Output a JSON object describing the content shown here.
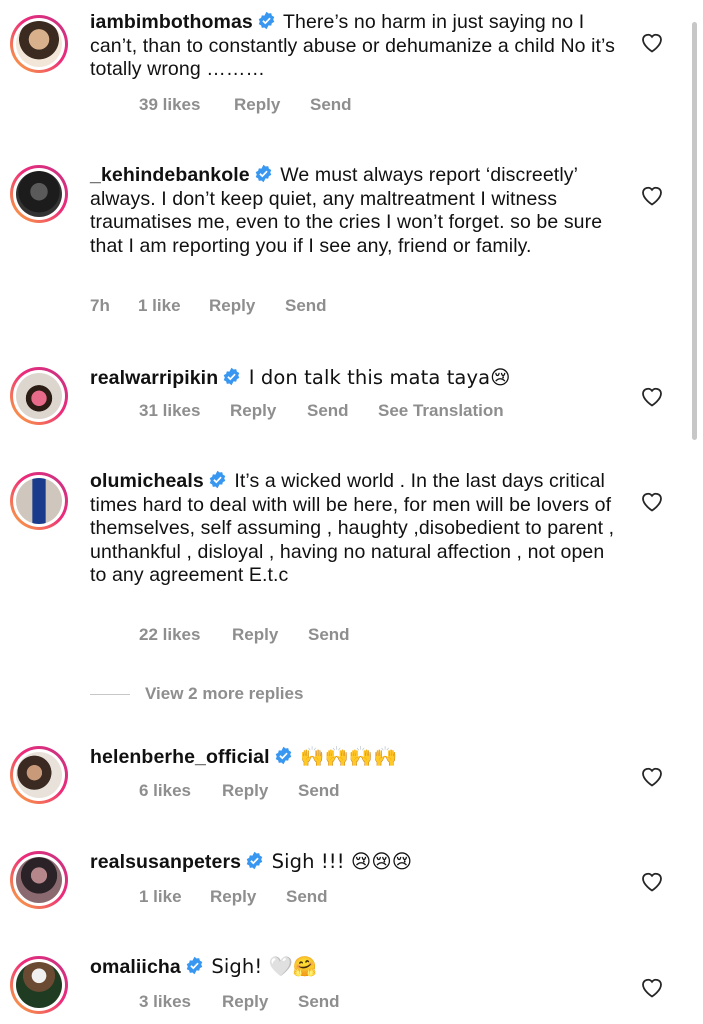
{
  "comments": [
    {
      "username": "iambimbothomas",
      "text": "There’s no harm in just saying no I can’t, than to constantly abuse or dehumanize a child No it’s totally wrong ………",
      "time": "",
      "likes": "39 likes",
      "reply": "Reply",
      "send": "Send",
      "translation": ""
    },
    {
      "username": "_kehindebankole",
      "text": "We must always report ‘discreetly’ always. I don’t keep quiet, any maltreatment I witness traumatises me, even to the cries I won’t forget. so be sure that I am reporting you if I see any, friend or family.",
      "time": "7h",
      "likes": "1 like",
      "reply": "Reply",
      "send": "Send",
      "translation": ""
    },
    {
      "username": "realwarripikin",
      "text": "I don talk this mata taya😢",
      "time": "",
      "likes": "31 likes",
      "reply": "Reply",
      "send": "Send",
      "translation": "See Translation"
    },
    {
      "username": "olumicheals",
      "text": "It’s a wicked world . In the last days critical times hard to deal with will be here, for men will be lovers of themselves, self assuming , haughty ,disobedient to parent , unthankful , disloyal , having no natural affection , not open to any agreement E.t.c",
      "time": "",
      "likes": "22 likes",
      "reply": "Reply",
      "send": "Send",
      "translation": ""
    },
    {
      "username": "helenberhe_official",
      "text": "🙌🙌🙌🙌",
      "time": "",
      "likes": "6 likes",
      "reply": "Reply",
      "send": "Send",
      "translation": ""
    },
    {
      "username": "realsusanpeters",
      "text": "Sigh !!! 😢😢😢",
      "time": "",
      "likes": "1 like",
      "reply": "Reply",
      "send": "Send",
      "translation": ""
    },
    {
      "username": "omaliicha",
      "text": "Sigh! 🤍🤗",
      "time": "",
      "likes": "3 likes",
      "reply": "Reply",
      "send": "Send",
      "translation": ""
    }
  ],
  "view_more_replies": "View 2 more replies",
  "icons": {
    "verified": "verified-badge-icon",
    "like": "heart-outline-icon"
  },
  "colors": {
    "verified_blue": "#3897f0",
    "meta_gray": "#8e8e8e",
    "text": "#111111",
    "story_ring_start": "#f9b23b",
    "story_ring_end": "#c13584"
  }
}
